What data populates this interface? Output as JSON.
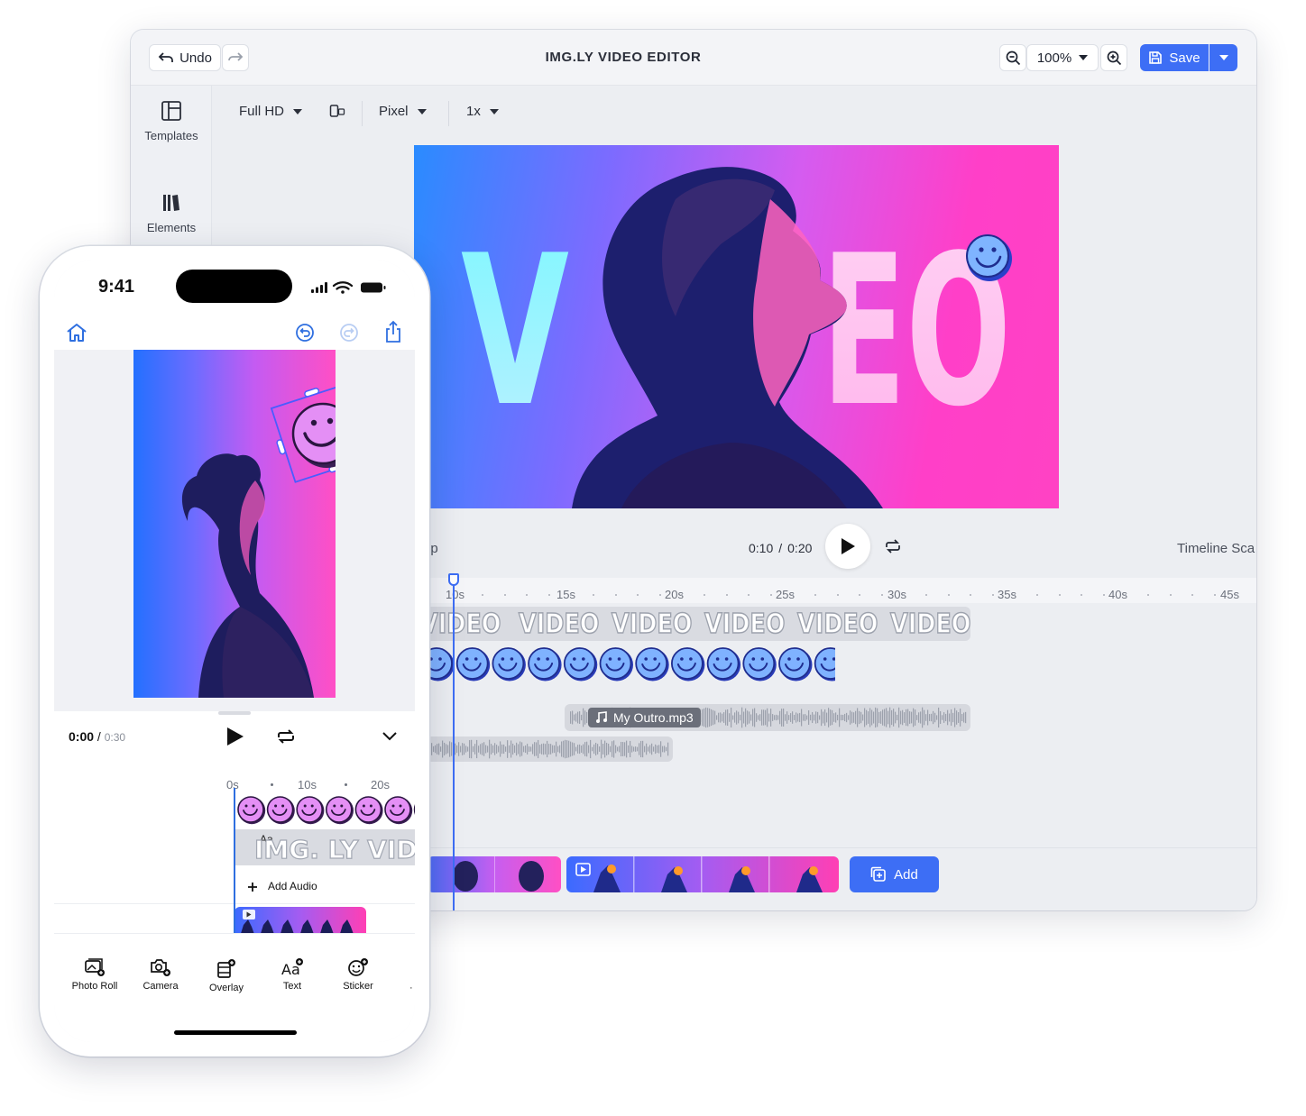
{
  "desktop": {
    "title": "IMG.LY VIDEO EDITOR",
    "undo_label": "Undo",
    "zoom_value": "100%",
    "save_label": "Save",
    "accent_color": "#3d6ef5",
    "rail": [
      {
        "label": "Templates",
        "icon": "templates-icon"
      },
      {
        "label": "Elements",
        "icon": "elements-icon"
      }
    ],
    "settings": {
      "resolution": "Full HD",
      "unit": "Pixel",
      "scale": "1x"
    },
    "canvas": {
      "headline": "VIDEO"
    },
    "playback": {
      "current": "0:10",
      "separator": "/",
      "total": "0:20",
      "clip_label": "ip",
      "timeline_scale_label": "Timeline Sca"
    },
    "ruler_labels": [
      "10s",
      "15s",
      "20s",
      "25s",
      "30s",
      "35s",
      "40s",
      "45s"
    ],
    "text_track_words": [
      "VIDEO",
      "VIDEO",
      "VIDEO",
      "VIDEO",
      "VIDEO",
      "VIDEO"
    ],
    "audio_file": "My Outro.mp3",
    "add_label": "Add"
  },
  "phone": {
    "status_time": "9:41",
    "time_current": "0:00",
    "time_separator": "/",
    "time_total": "0:30",
    "ruler_labels": [
      "0s",
      "10s",
      "20s"
    ],
    "text_clip_label": "IMG. LY VIDE",
    "text_badge": "Aa",
    "add_audio_label": "Add Audio",
    "tools": [
      {
        "label": "Photo Roll",
        "icon": "photo-roll-icon"
      },
      {
        "label": "Camera",
        "icon": "camera-icon"
      },
      {
        "label": "Overlay",
        "icon": "overlay-icon"
      },
      {
        "label": "Text",
        "icon": "text-icon"
      },
      {
        "label": "Sticker",
        "icon": "sticker-icon"
      }
    ],
    "accent_color": "#2f6fe0"
  }
}
